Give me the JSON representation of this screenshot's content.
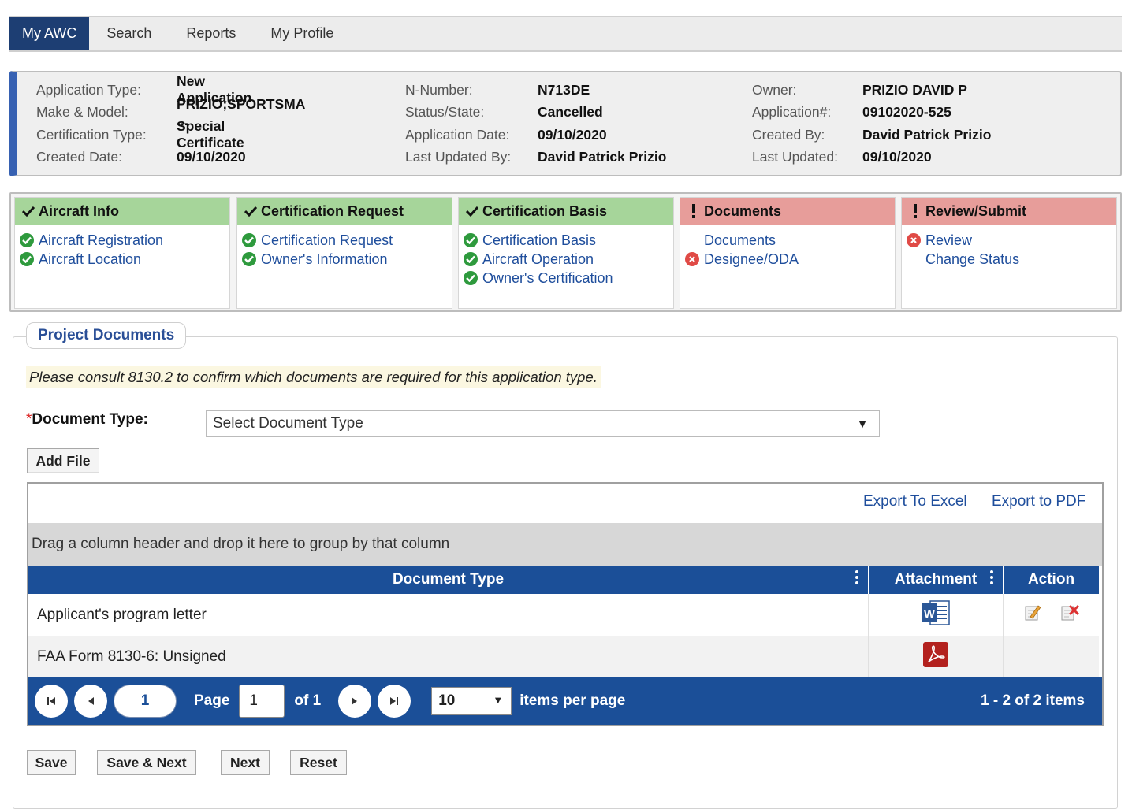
{
  "nav": {
    "tabs": [
      "My AWC",
      "Search",
      "Reports",
      "My Profile"
    ],
    "active": "My AWC"
  },
  "summary": {
    "col1": [
      {
        "label": "Application Type:",
        "value": "New Application"
      },
      {
        "label": "Make & Model:",
        "value": "PRIZIO;SPORTSMA ..."
      },
      {
        "label": "Certification Type:",
        "value": "Special Certificate"
      },
      {
        "label": "Created Date:",
        "value": "09/10/2020"
      }
    ],
    "col2": [
      {
        "label": "N-Number:",
        "value": "N713DE"
      },
      {
        "label": "Status/State:",
        "value": "Cancelled"
      },
      {
        "label": "Application Date:",
        "value": "09/10/2020"
      },
      {
        "label": "Last Updated By:",
        "value": "David Patrick Prizio"
      }
    ],
    "col3": [
      {
        "label": "Owner:",
        "value": "PRIZIO DAVID P"
      },
      {
        "label": "Application#:",
        "value": "09102020-525"
      },
      {
        "label": "Created By:",
        "value": "David Patrick Prizio"
      },
      {
        "label": "Last Updated:",
        "value": "09/10/2020"
      }
    ]
  },
  "steps": [
    {
      "title": "Aircraft Info",
      "status": "complete",
      "items": [
        {
          "label": "Aircraft Registration",
          "state": "ok"
        },
        {
          "label": "Aircraft Location",
          "state": "ok"
        }
      ]
    },
    {
      "title": "Certification Request",
      "status": "complete",
      "items": [
        {
          "label": "Certification Request",
          "state": "ok"
        },
        {
          "label": "Owner's Information",
          "state": "ok"
        }
      ]
    },
    {
      "title": "Certification Basis",
      "status": "complete",
      "items": [
        {
          "label": "Certification Basis",
          "state": "ok"
        },
        {
          "label": "Aircraft Operation",
          "state": "ok"
        },
        {
          "label": "Owner's Certification",
          "state": "ok"
        }
      ]
    },
    {
      "title": "Documents",
      "status": "incomplete",
      "items": [
        {
          "label": "Documents",
          "state": "none"
        },
        {
          "label": "Designee/ODA",
          "state": "error"
        }
      ]
    },
    {
      "title": "Review/Submit",
      "status": "incomplete",
      "items": [
        {
          "label": "Review",
          "state": "error"
        },
        {
          "label": "Change Status",
          "state": "none"
        }
      ]
    }
  ],
  "documents": {
    "legend": "Project Documents",
    "notice": "Please consult 8130.2 to confirm which documents are required for this application type.",
    "required_mark": "*",
    "doc_type_label": "Document Type:",
    "doc_type_selected": "Select Document Type",
    "add_file": "Add File"
  },
  "grid": {
    "export_excel": "Export To Excel",
    "export_pdf": "Export to PDF",
    "group_hint": "Drag a column header and drop it here to group by that column",
    "columns": [
      "Document Type",
      "Attachment",
      "Action"
    ],
    "rows": [
      {
        "document_type": "Applicant's program letter",
        "attachment": "word-file-icon",
        "actions": [
          "edit-icon",
          "delete-icon"
        ]
      },
      {
        "document_type": "FAA Form 8130-6: Unsigned",
        "attachment": "pdf-file-icon",
        "actions": []
      }
    ],
    "pager": {
      "current": "1",
      "page_label": "Page",
      "page_input": "1",
      "of_label": "of 1",
      "page_size": "10",
      "per_page_label": "items per page",
      "summary": "1 - 2 of 2 items"
    }
  },
  "buttons": {
    "save": "Save",
    "save_next": "Save & Next",
    "next": "Next",
    "reset": "Reset"
  },
  "colors": {
    "nav_active": "#1d3e73",
    "grid_header": "#1b4f98",
    "step_ok": "#a6d59a",
    "step_bad": "#e79d9a",
    "link": "#1f4e9c"
  }
}
